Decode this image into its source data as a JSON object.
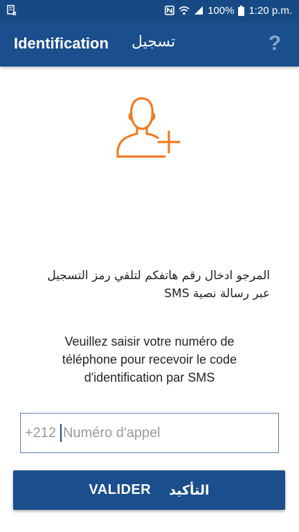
{
  "status_bar": {
    "battery_text": "100%",
    "time": "1:20 p.m.",
    "icons": [
      "notification-icon",
      "nfc-icon",
      "wifi-icon",
      "signal-icon",
      "battery-icon"
    ]
  },
  "app_bar": {
    "title_fr": "Identification",
    "title_ar": "تسجيل",
    "help_label": "?"
  },
  "main": {
    "avatar_icon": "add-user-icon",
    "instruction_ar": {
      "line1": "المرجو ادخال رقم هاتفكم لتلقي رمز التسجيل",
      "line2": "عبر رسالة نصية SMS"
    },
    "instruction_fr": {
      "line1": "Veuillez saisir votre numéro de",
      "line2": "téléphone pour recevoir le code",
      "line3": "d'identification par SMS"
    },
    "phone_field": {
      "prefix": "+212",
      "placeholder": "Numéro d'appel",
      "value": ""
    },
    "submit": {
      "label_fr": "VALIDER",
      "label_ar": "التأكيد"
    }
  },
  "colors": {
    "primary": "#1a4e8c",
    "status_bar": "#174a84",
    "accent_orange": "#f07a24",
    "help_icon": "#8ba6c7"
  }
}
